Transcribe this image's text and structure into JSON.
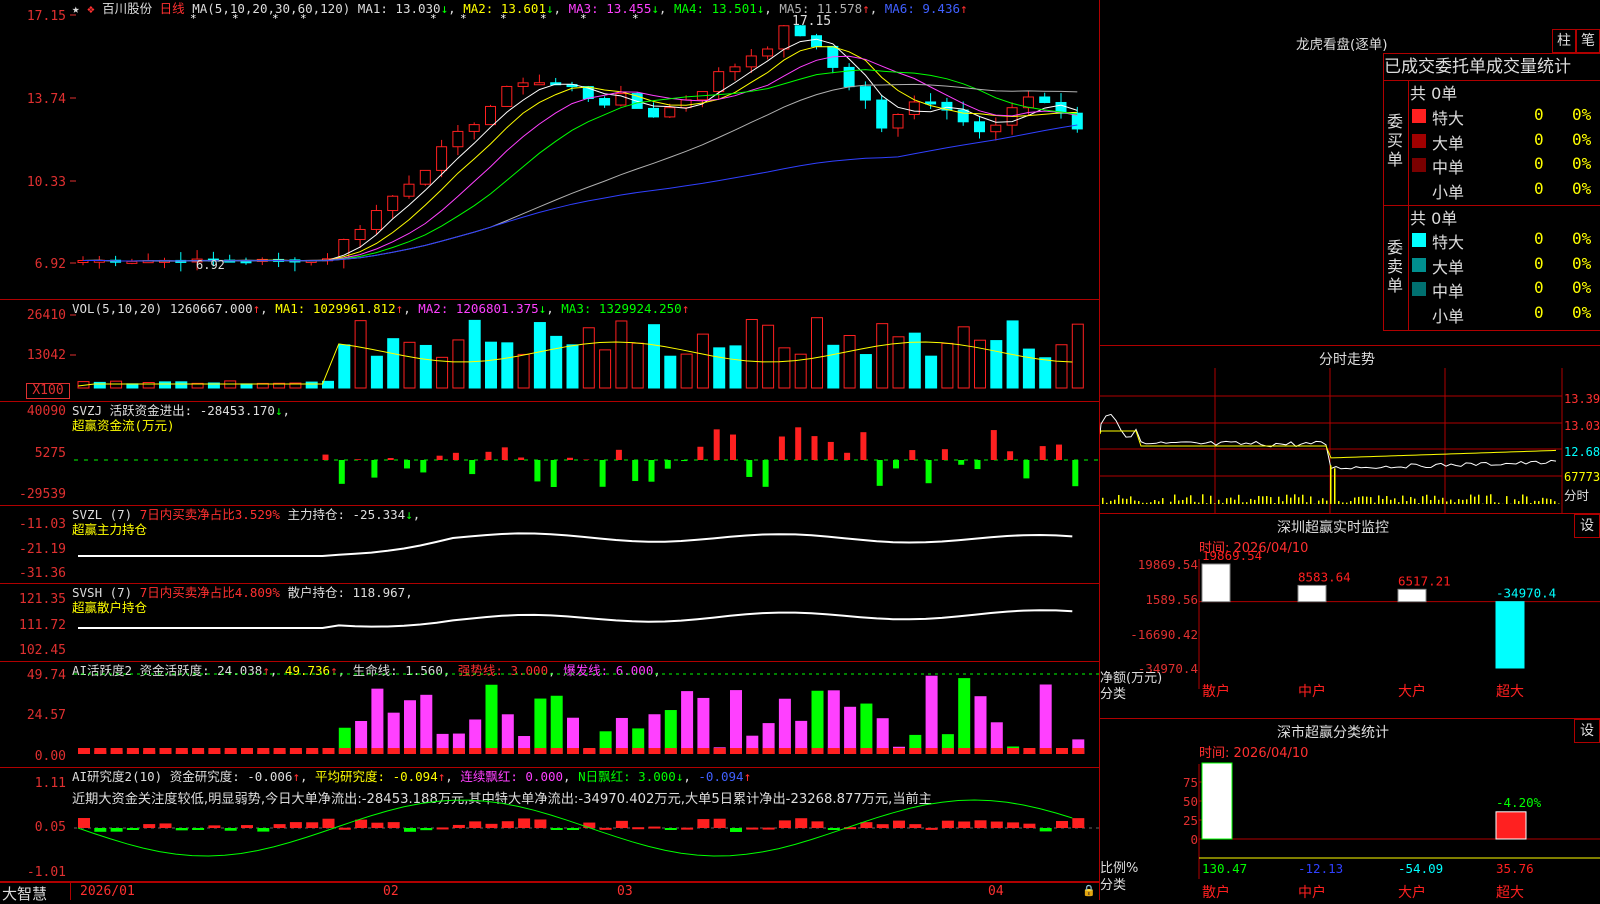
{
  "stock": {
    "star": "★",
    "name": "百川股份",
    "period": "日线",
    "logo": "大智慧",
    "lock": "🔒"
  },
  "colors": {
    "up": "#ff2020",
    "down": "#00ffff",
    "grid": "#b00000",
    "axis": "#e03030",
    "ma1": "#ffffff",
    "ma2": "#ffff00",
    "ma3": "#ff40ff",
    "ma4": "#00ff00",
    "ma5": "#b0b0b0",
    "ma6": "#3040ff"
  },
  "kline": {
    "header": {
      "ma_label": "MA(5,10,20,30,60,120)",
      "ma1": "MA1: 13.030",
      "ma2": "MA2: 13.601",
      "ma3": "MA3: 13.455",
      "ma4": "MA4: 13.501",
      "ma5": "MA5: 11.578",
      "ma6": "MA6: 9.436"
    },
    "y_ticks": [
      "17.15",
      "13.74",
      "10.33",
      "6.92"
    ],
    "high_label": "17.15",
    "low_label": "6.92",
    "stars": [
      "*",
      "*",
      "*",
      "*",
      "*",
      "*",
      "*",
      "*",
      "*",
      "*"
    ]
  },
  "volume": {
    "header": {
      "label": "VOL(5,10,20)",
      "vol": "1260667.000",
      "ma1": "MA1: 1029961.812",
      "ma2": "MA2: 1206801.375",
      "ma3": "MA3: 1329924.250"
    },
    "y_ticks": [
      "26410",
      "13042"
    ],
    "unit": "X100"
  },
  "svzj": {
    "header": {
      "label": "SVZJ",
      "text": "活跃资金进出: -28453.170",
      "sub": "超赢资金流(万元)"
    },
    "y_ticks": [
      "40090",
      "5275",
      "-29539"
    ]
  },
  "svzl": {
    "header": {
      "label": "SVZL (7)",
      "ratio": "7日内买卖净占比3.529%",
      "hold": "主力持仓: -25.334",
      "sub": "超赢主力持仓"
    },
    "y_ticks": [
      "-11.03",
      "-21.19",
      "-31.36"
    ]
  },
  "svsh": {
    "header": {
      "label": "SVSH (7)",
      "ratio": "7日内买卖净占比4.809%",
      "hold": "散户持仓: 118.967",
      "sub": "超赢散户持仓"
    },
    "y_ticks": [
      "121.35",
      "111.72",
      "102.45"
    ]
  },
  "ai1": {
    "header": {
      "label": "AI活跃度2",
      "act": "资金活跃度: 24.038",
      "v2": "49.736",
      "life": "生命线: 1.560",
      "strong": "强势线: 3.000",
      "burst": "爆发线: 6.000"
    },
    "y_ticks": [
      "49.74",
      "24.57",
      "0.00"
    ]
  },
  "ai2": {
    "header": {
      "label": "AI研究度2(10)",
      "res": "资金研究度: -0.006",
      "avg": "平均研究度: -0.094",
      "lianxu": "连续飘红: 0.000",
      "nday": "N日飘红: 3.000",
      "v": "-0.094"
    },
    "text": "近期大资金关注度较低,明显弱势,今日大单净流出:-28453.188万元,其中特大单净流出:-34970.402万元,大单5日累计净出-23268.877万元,当前主",
    "y_ticks": [
      "1.11",
      "0.05",
      "-1.01"
    ]
  },
  "xaxis": {
    "labels": [
      "2026/01",
      "02",
      "03",
      "04"
    ]
  },
  "dragon": {
    "title": "龙虎看盘(逐单)",
    "btn1": "柱",
    "btn2": "笔",
    "tabs": [
      "已成交",
      "委托单",
      "成交量",
      "统计"
    ],
    "buy": {
      "side": "委买单",
      "total": "共 0单",
      "rows": [
        {
          "label": "特大",
          "val": "0",
          "pct": "0%",
          "color": "#ff2020"
        },
        {
          "label": "大单",
          "val": "0",
          "pct": "0%",
          "color": "#a00000"
        },
        {
          "label": "中单",
          "val": "0",
          "pct": "0%",
          "color": "#7a0000"
        },
        {
          "label": "小单",
          "val": "0",
          "pct": "0%",
          "color": "#000000"
        }
      ]
    },
    "sell": {
      "side": "委卖单",
      "total": "共 0单",
      "rows": [
        {
          "label": "特大",
          "val": "0",
          "pct": "0%",
          "color": "#00ffff"
        },
        {
          "label": "大单",
          "val": "0",
          "pct": "0%",
          "color": "#008f8f"
        },
        {
          "label": "中单",
          "val": "0",
          "pct": "0%",
          "color": "#007070"
        },
        {
          "label": "小单",
          "val": "0",
          "pct": "0%",
          "color": "#000000"
        }
      ]
    }
  },
  "intraday": {
    "title": "分时走势",
    "labels": [
      "13.39",
      "13.03",
      "12.68",
      "67773",
      "分时"
    ]
  },
  "monitor": {
    "title": "深圳超赢实时监控",
    "set": "设",
    "time": "时间: 2026/04/10",
    "y_ticks": [
      "19869.54",
      "1589.56",
      "-16690.42",
      "-34970.4"
    ],
    "ylabel": "净额(万元)",
    "xlabel": "分类",
    "categories": [
      "散户",
      "中户",
      "大户",
      "超大"
    ],
    "values": [
      19869.54,
      8583.64,
      6517.21,
      -34970.4
    ],
    "value_labels": [
      "19869.54",
      "8583.64",
      "6517.21",
      "-34970.4"
    ]
  },
  "classify": {
    "title": "深市超赢分类统计",
    "set": "设",
    "time": "时间: 2026/04/10",
    "y_ticks": [
      "75",
      "50",
      "25",
      "0"
    ],
    "ylabel": "比例%",
    "xlabel": "分类",
    "categories": [
      "散户",
      "中户",
      "大户",
      "超大"
    ],
    "values": [
      130.47,
      -12.13,
      -54.09,
      35.76
    ],
    "value_labels": [
      "130.47",
      "-12.13",
      "-54.09",
      "35.76"
    ],
    "extra_label": "-4.20%"
  },
  "chart_data": {
    "type": "bar",
    "title": "深圳超赢实时监控",
    "categories": [
      "散户",
      "中户",
      "大户",
      "超大"
    ],
    "values": [
      19869.54,
      8583.64,
      6517.21,
      -34970.4
    ],
    "ylabel": "净额(万元)",
    "xlabel": "分类",
    "ylim": [
      -34970.4,
      19869.54
    ]
  }
}
